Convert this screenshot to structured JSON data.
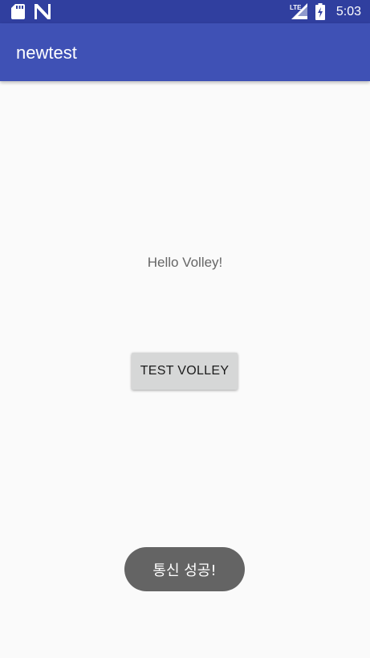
{
  "status_bar": {
    "time": "5:03",
    "network_label": "LTE",
    "icons": [
      "sd-card-icon",
      "n-logo-icon",
      "lte-signal-icon",
      "battery-charging-icon"
    ]
  },
  "app_bar": {
    "title": "newtest"
  },
  "content": {
    "hello_text": "Hello Volley!",
    "test_button_label": "TEST VOLLEY"
  },
  "toast": {
    "message": "통신 성공!"
  },
  "colors": {
    "status_bar": "#303f9f",
    "app_bar": "#3f51b5",
    "background": "#fafafa",
    "button": "#d6d7d7",
    "toast": "#646464"
  }
}
